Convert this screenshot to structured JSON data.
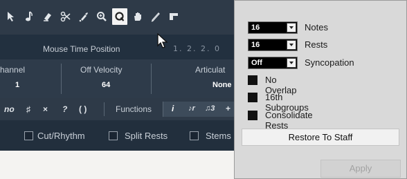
{
  "editor": {
    "time": {
      "label": "Mouse Time Position",
      "value": "1. 2. 2.  0"
    },
    "params": {
      "channel_label": "hannel",
      "channel_value": "1",
      "off_velocity_label": "Off Velocity",
      "off_velocity_value": "64",
      "articulation_label": "Articulat",
      "articulation_value": "None"
    },
    "functions_label": "Functions",
    "options": {
      "cut_rhythm": "Cut/Rhythm",
      "split_rests": "Split Rests",
      "stems": "Stems"
    }
  },
  "panel": {
    "notes": {
      "value": "16",
      "label": "Notes"
    },
    "rests": {
      "value": "16",
      "label": "Rests"
    },
    "syncopation": {
      "value": "Off",
      "label": "Syncopation"
    },
    "no_overlap": "No Overlap",
    "subgroups": "16th Subgroups",
    "consolidate": "Consolidate Rests",
    "restore_button": "Restore To Staff",
    "apply_button": "Apply"
  }
}
